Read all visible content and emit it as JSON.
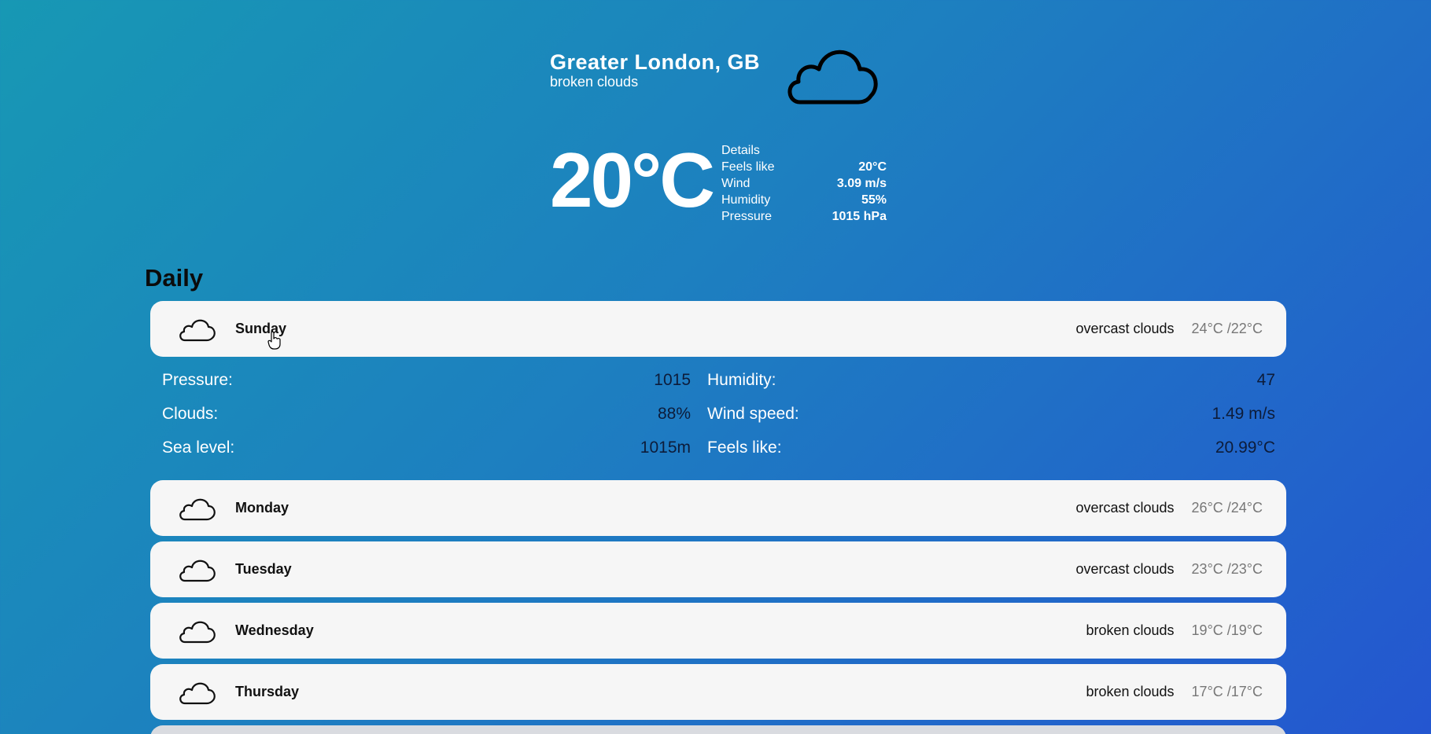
{
  "current": {
    "location": "Greater London, GB",
    "description": "broken clouds",
    "temperature": "20°C",
    "icon": "cloud-icon",
    "details": {
      "title": "Details",
      "rows": [
        {
          "label": "Feels like",
          "value": "20°C"
        },
        {
          "label": "Wind",
          "value": "3.09 m/s"
        },
        {
          "label": "Humidity",
          "value": "55%"
        },
        {
          "label": "Pressure",
          "value": "1015 hPa"
        }
      ]
    }
  },
  "daily": {
    "title": "Daily",
    "days": [
      {
        "name": "Sunday",
        "description": "overcast clouds",
        "range": "24°C /22°C",
        "icon": "cloud-icon"
      },
      {
        "name": "Monday",
        "description": "overcast clouds",
        "range": "26°C /24°C",
        "icon": "cloud-icon"
      },
      {
        "name": "Tuesday",
        "description": "overcast clouds",
        "range": "23°C /23°C",
        "icon": "cloud-icon"
      },
      {
        "name": "Wednesday",
        "description": "broken clouds",
        "range": "19°C /19°C",
        "icon": "cloud-icon"
      },
      {
        "name": "Thursday",
        "description": "broken clouds",
        "range": "17°C /17°C",
        "icon": "cloud-icon"
      }
    ],
    "expanded": {
      "left": [
        {
          "label": "Pressure:",
          "value": "1015"
        },
        {
          "label": "Clouds:",
          "value": "88%"
        },
        {
          "label": "Sea level:",
          "value": "1015m"
        }
      ],
      "right": [
        {
          "label": "Humidity:",
          "value": "47"
        },
        {
          "label": "Wind speed:",
          "value": "1.49 m/s"
        },
        {
          "label": "Feels like:",
          "value": "20.99°C"
        }
      ]
    }
  },
  "colors": {
    "gradient_start": "#1798b4",
    "gradient_end": "#2456d0",
    "card": "#f6f6f6"
  }
}
